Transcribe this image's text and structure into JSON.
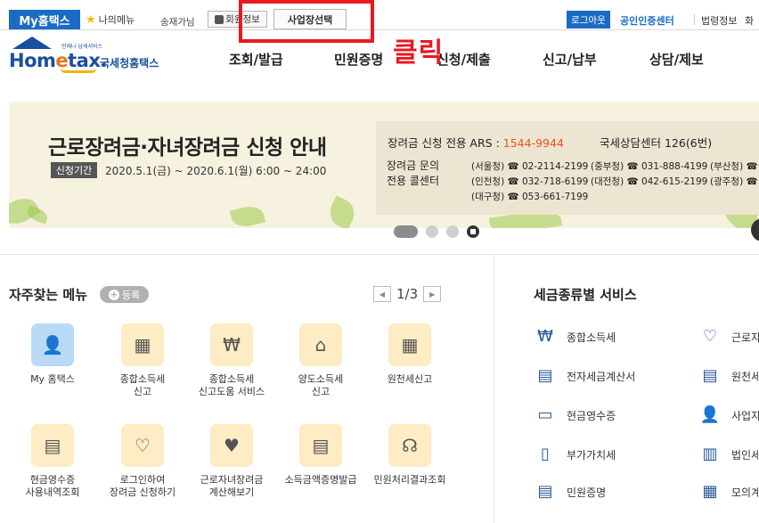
{
  "topbar": {
    "my_hometax": "My홈택스",
    "my_menu": "나의메뉴",
    "user_name": "송재가님",
    "member_info": "회원정보",
    "workplace_select": "사업장선택",
    "logout": "로그아웃",
    "cert_center": "공인인증센터",
    "law_info": "법령정보",
    "law_info_cut": "화"
  },
  "logo": {
    "tagline": "언제나 납세서비스",
    "main": "Hom",
    "main_e": "e",
    "main_tail": "tax.",
    "kr": "국세청홈택스"
  },
  "nav": {
    "items": [
      "조회/발급",
      "민원증명",
      "신청/제출",
      "신고/납부",
      "상담/제보"
    ]
  },
  "annotation": {
    "click_text": "클릭",
    "accent_color": "#e8191f"
  },
  "banner": {
    "title": "근로장려금·자녀장려금 신청 안내",
    "period_label": "신청기간",
    "period": "2020.5.1(금) ~ 2020.6.1(월) 6:00 ~ 24:00",
    "ars_label": "장려금 신청 전용 ARS :",
    "ars_number": "1544-9944",
    "center_label": "국세상담센터",
    "center_number": "126(6번)",
    "inquiry_label_1": "장려금 문의",
    "inquiry_label_2": "전용 콜센터",
    "phones": [
      {
        "region": "(서울청)",
        "number": "☎ 02-2114-2199"
      },
      {
        "region": "(중부청)",
        "number": "☎ 031-888-4199"
      },
      {
        "region": "(부산청)",
        "number": "☎"
      },
      {
        "region": "(인천청)",
        "number": "☎ 032-718-6199"
      },
      {
        "region": "(대전청)",
        "number": "☎ 042-615-2199"
      },
      {
        "region": "(광주청)",
        "number": "☎"
      },
      {
        "region": "(대구청)",
        "number": "☎ 053-661-7199"
      }
    ]
  },
  "favorites": {
    "title": "자주찾는 메뉴",
    "add_label": "등록",
    "page": "1/3",
    "items": [
      {
        "label": "My 홈택스",
        "icon": "person-icon",
        "highlight": true
      },
      {
        "label": "종합소득세\n신고",
        "icon": "calendar-pen-icon"
      },
      {
        "label": "종합소득세\n신고도움 서비스",
        "icon": "won-search-icon"
      },
      {
        "label": "양도소득세\n신고",
        "icon": "house-pen-icon"
      },
      {
        "label": "원천세신고",
        "icon": "calendar-pen-icon"
      },
      {
        "label": "현금영수증\n사용내역조회",
        "icon": "receipt-search-icon"
      },
      {
        "label": "로그인하여\n장려금 신청하기",
        "icon": "heart-hand-icon"
      },
      {
        "label": "근로자녀장려금\n계산해보기",
        "icon": "heart-doc-icon"
      },
      {
        "label": "소득금액증명발급",
        "icon": "certificate-icon"
      },
      {
        "label": "민원처리결과조회",
        "icon": "headset-icon"
      }
    ]
  },
  "tax_services": {
    "title": "세금종류별 서비스",
    "left": [
      {
        "label": "종합소득세",
        "icon": "won-coins-icon"
      },
      {
        "label": "전자세금계산서",
        "icon": "invoice-icon"
      },
      {
        "label": "현금영수증",
        "icon": "receipt-1000-icon"
      },
      {
        "label": "부가가치세",
        "icon": "vat-icon"
      },
      {
        "label": "민원증명",
        "icon": "document-icon"
      }
    ],
    "right": [
      {
        "label": "근로자",
        "icon": "heart-hand-icon"
      },
      {
        "label": "원천세",
        "icon": "sal-doc-icon"
      },
      {
        "label": "사업자",
        "icon": "person-icon"
      },
      {
        "label": "법인세",
        "icon": "building-icon"
      },
      {
        "label": "모의계",
        "icon": "calculator-icon"
      }
    ]
  }
}
